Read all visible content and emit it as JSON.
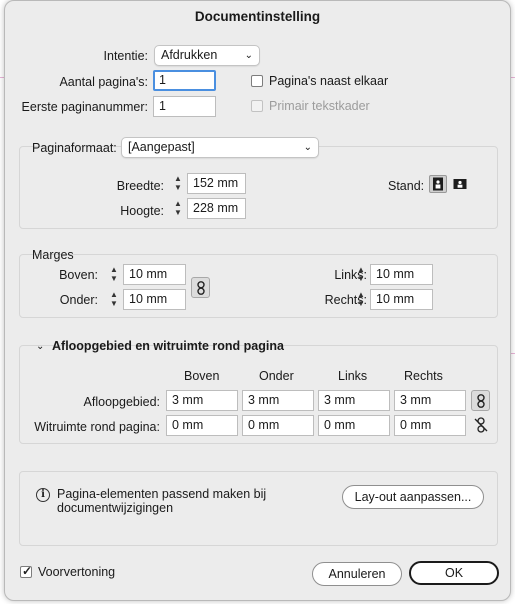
{
  "dialog": {
    "title": "Documentinstelling"
  },
  "top": {
    "intent_label": "Intentie:",
    "intent_value": "Afdrukken",
    "pages_label": "Aantal pagina's:",
    "pages_value": "1",
    "start_label": "Eerste paginanummer:",
    "start_value": "1",
    "facing_label": "Pagina's naast elkaar",
    "facing_checked": false,
    "primary_frame_label": "Primair tekstkader",
    "primary_frame_enabled": false
  },
  "page_size": {
    "label": "Paginaformaat:",
    "preset": "[Aangepast]",
    "width_label": "Breedte:",
    "width_value": "152 mm",
    "height_label": "Hoogte:",
    "height_value": "228 mm",
    "orientation_label": "Stand:",
    "orientation": "portrait"
  },
  "margins": {
    "title": "Marges",
    "top_label": "Boven:",
    "top_value": "10 mm",
    "bottom_label": "Onder:",
    "bottom_value": "10 mm",
    "left_label": "Links:",
    "left_value": "10 mm",
    "right_label": "Rechts:",
    "right_value": "10 mm"
  },
  "bleed": {
    "title": "Afloopgebied en witruimte rond pagina",
    "col_top": "Boven",
    "col_bottom": "Onder",
    "col_left": "Links",
    "col_right": "Rechts",
    "bleed_label": "Afloopgebied:",
    "bleed_values": [
      "3 mm",
      "3 mm",
      "3 mm",
      "3 mm"
    ],
    "slug_label": "Witruimte rond pagina:",
    "slug_values": [
      "0 mm",
      "0 mm",
      "0 mm",
      "0 mm"
    ]
  },
  "info": {
    "text_line1": "Pagina-elementen passend maken bij",
    "text_line2": "documentwijzigingen",
    "adjust_button": "Lay-out aanpassen..."
  },
  "footer": {
    "preview_label": "Voorvertoning",
    "preview_checked": true,
    "cancel": "Annuleren",
    "ok": "OK"
  }
}
